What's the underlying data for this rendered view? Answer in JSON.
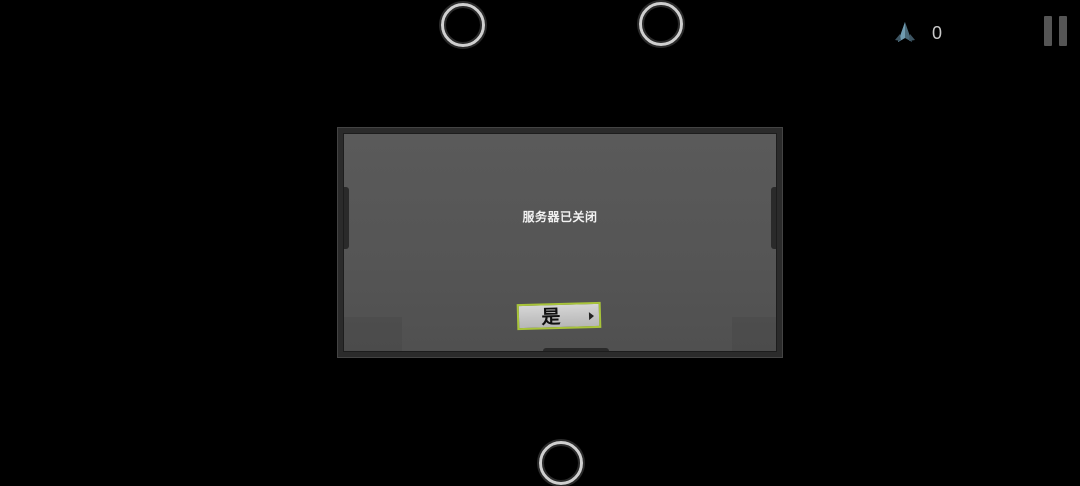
{
  "hud": {
    "score_icon": "ship-icon",
    "score_value": "0",
    "pause_icon": "pause-icon"
  },
  "controls": {
    "ring_icon": "circle-ring-icon"
  },
  "dialog": {
    "message": "服务器已关闭",
    "confirm_label": "是",
    "confirm_icon": "arrow-right-icon"
  },
  "colors": {
    "background": "#000000",
    "panel": "#555555",
    "panel_frame": "#2b2b2b",
    "button_border": "#a8c43a",
    "text": "#f2f2f2"
  }
}
